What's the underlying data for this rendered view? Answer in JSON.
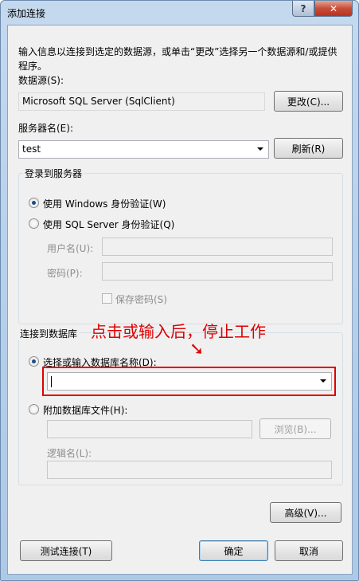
{
  "window": {
    "title": "添加连接",
    "help": "?",
    "close": "✕"
  },
  "description": "输入信息以连接到选定的数据源，或单击“更改”选择另一个数据源和/或提供程序。",
  "datasource": {
    "label": "数据源(S):",
    "value": "Microsoft SQL Server (SqlClient)",
    "change_button": "更改(C)..."
  },
  "server": {
    "label": "服务器名(E):",
    "value": "test",
    "refresh_button": "刷新(R)"
  },
  "login": {
    "legend": "登录到服务器",
    "windows_auth": "使用 Windows 身份验证(W)",
    "sql_auth": "使用 SQL Server 身份验证(Q)",
    "username_label": "用户名(U):",
    "password_label": "密码(P):",
    "save_password": "保存密码(S)"
  },
  "database": {
    "legend": "连接到数据库",
    "select_option": "选择或输入数据库名称(D):",
    "attach_option": "附加数据库文件(H):",
    "browse_button": "浏览(B)...",
    "logical_name_label": "逻辑名(L):"
  },
  "annotation": {
    "text": "点击或输入后，停止工作",
    "arrow": "➘",
    "color": "#e00000"
  },
  "footer": {
    "advanced_button": "高级(V)...",
    "test_button": "测试连接(T)",
    "ok_button": "确定",
    "cancel_button": "取消"
  }
}
